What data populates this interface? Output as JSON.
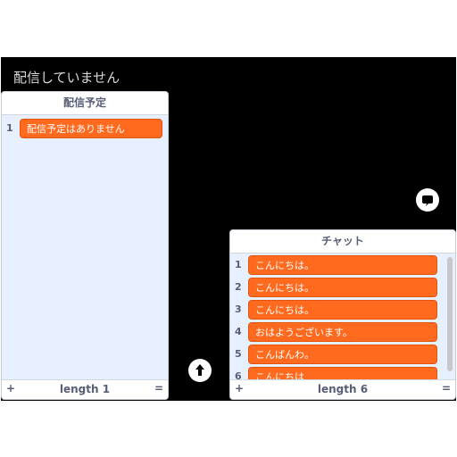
{
  "stage": {
    "status_text": "配信していません"
  },
  "schedule_list": {
    "title": "配信予定",
    "items": [
      {
        "index": "1",
        "value": "配信予定はありません"
      }
    ],
    "add": "+",
    "length": "length 1",
    "resize": "="
  },
  "chat_list": {
    "title": "チャット",
    "items": [
      {
        "index": "1",
        "value": "こんにちは。"
      },
      {
        "index": "2",
        "value": "こんにちは。"
      },
      {
        "index": "3",
        "value": "こんにちは。"
      },
      {
        "index": "4",
        "value": "おはようございます。"
      },
      {
        "index": "5",
        "value": "こんばんわ。"
      },
      {
        "index": "6",
        "value": "こんにちは"
      }
    ],
    "add": "+",
    "length": "length 6",
    "resize": "="
  },
  "icons": {
    "chat": "chat-bubble-icon",
    "scroll_up": "arrow-up-icon"
  },
  "colors": {
    "stage_bg": "#000000",
    "item_bg": "#ff6a1f",
    "panel_bg": "#e6f0ff"
  }
}
